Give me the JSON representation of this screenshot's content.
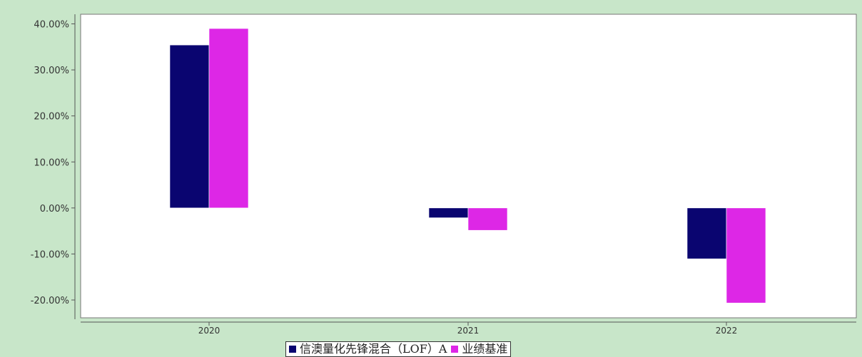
{
  "chart_data": {
    "type": "bar",
    "title": "",
    "xlabel": "",
    "ylabel": "",
    "categories": [
      "2020",
      "2021",
      "2022"
    ],
    "series": [
      {
        "name": "信澳量化先锋混合（LOF）A",
        "values": [
          35.41,
          -2.13,
          -11.05
        ],
        "color": "#0a0570"
      },
      {
        "name": "业绩基准",
        "values": [
          38.99,
          -4.86,
          -20.65
        ],
        "color": "#dd27e6"
      }
    ],
    "ylim": [
      -24,
      40
    ],
    "y_ticks": [
      {
        "value": 40,
        "label": "40.00%"
      },
      {
        "value": 30,
        "label": "30.00%"
      },
      {
        "value": 20,
        "label": "20.00%"
      },
      {
        "value": 10,
        "label": "10.00%"
      },
      {
        "value": 0,
        "label": "0.00%"
      },
      {
        "value": -10,
        "label": "-10.00%"
      },
      {
        "value": -20,
        "label": "-20.00%"
      }
    ],
    "grid": false,
    "legend_position": "bottom-center"
  },
  "colors": {
    "background": "#c8e6c9",
    "plot_background": "#ffffff",
    "axis": "#555555"
  }
}
